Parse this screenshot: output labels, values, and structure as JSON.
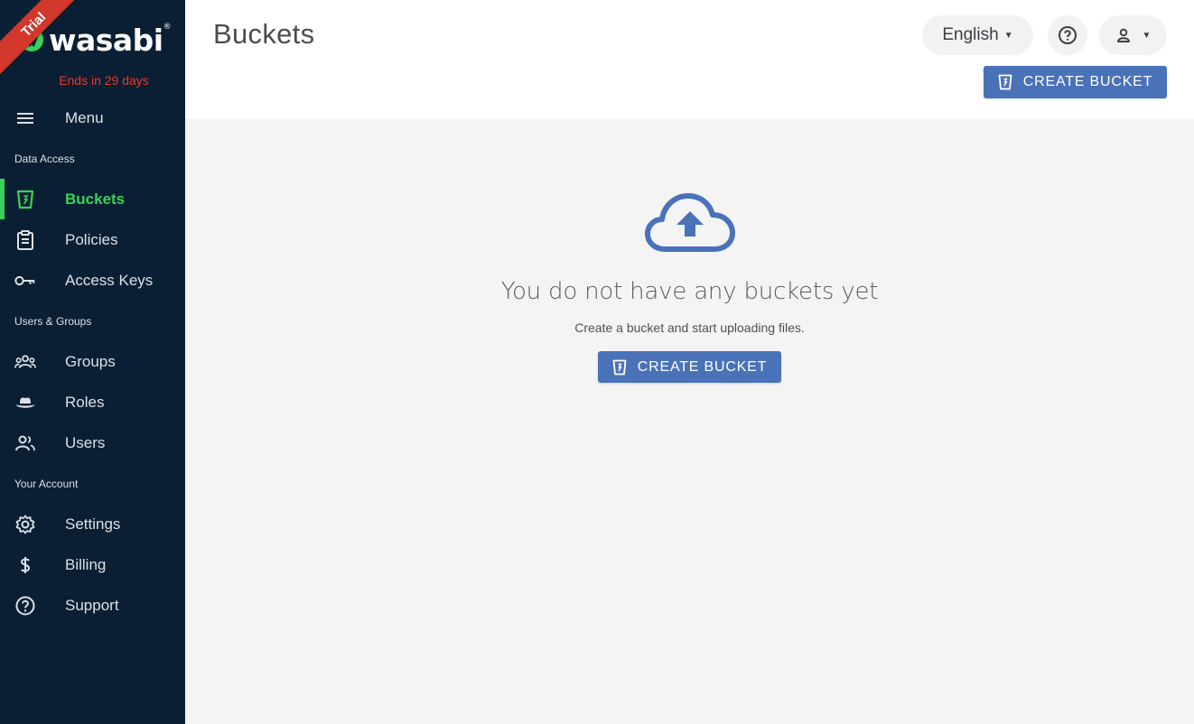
{
  "sidebar": {
    "trial_ribbon": "Trial",
    "logo_text": "wasabi",
    "logo_mark": "®",
    "trial_ends": "Ends in 29 days",
    "menu_label": "Menu",
    "sections": {
      "data_access": "Data Access",
      "users_groups": "Users & Groups",
      "your_account": "Your Account"
    },
    "items": {
      "buckets": "Buckets",
      "policies": "Policies",
      "access_keys": "Access Keys",
      "groups": "Groups",
      "roles": "Roles",
      "users": "Users",
      "settings": "Settings",
      "billing": "Billing",
      "support": "Support"
    },
    "active_color": "#3ad15a",
    "background": "#0a1f33"
  },
  "header": {
    "title": "Buckets",
    "language": "English",
    "create_label": "CREATE BUCKET"
  },
  "main": {
    "empty_title": "You do not have any buckets yet",
    "empty_subtitle": "Create a bucket and start uploading files.",
    "create_label": "CREATE BUCKET",
    "accent_color": "#4a72b8"
  }
}
